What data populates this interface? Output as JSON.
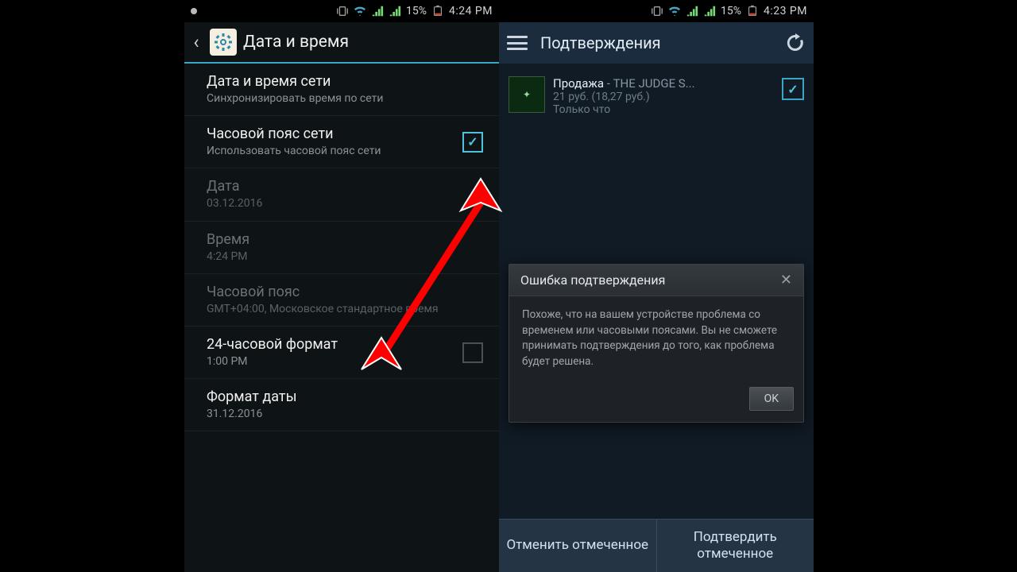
{
  "left": {
    "status": {
      "battery_pct": "15%",
      "time": "4:24 PM"
    },
    "header": {
      "title": "Дата и время"
    },
    "rows": {
      "net_time": {
        "title": "Дата и время сети",
        "sub": "Синхронизировать время по сети"
      },
      "net_tz": {
        "title": "Часовой пояс сети",
        "sub": "Использовать часовой пояс сети"
      },
      "date": {
        "title": "Дата",
        "sub": "03.12.2016"
      },
      "time": {
        "title": "Время",
        "sub": "4:24 PM"
      },
      "tz": {
        "title": "Часовой пояс",
        "sub": "GMT+04:00, Московское стандартное время"
      },
      "fmt24": {
        "title": "24-часовой формат",
        "sub": "1:00 PM"
      },
      "datefmt": {
        "title": "Формат даты",
        "sub": "31.12.2016"
      }
    }
  },
  "right": {
    "status": {
      "battery_pct": "15%",
      "time": "4:23 PM"
    },
    "header": {
      "title": "Подтверждения"
    },
    "confirmation": {
      "title_strong": "Продажа",
      "title_rest": " - THE JUDGE S...",
      "price": "21 руб. (18,27 руб.)",
      "when": "Только что"
    },
    "dialog": {
      "title": "Ошибка подтверждения",
      "body": "Похоже, что на вашем устройстве проблема со временем или часовыми поясами. Вы не сможете принимать подтверждения до того, как проблема будет решена.",
      "ok": "OK"
    },
    "actions": {
      "cancel": "Отменить отмеченное",
      "confirm": "Подтвердить отмеченное"
    }
  }
}
